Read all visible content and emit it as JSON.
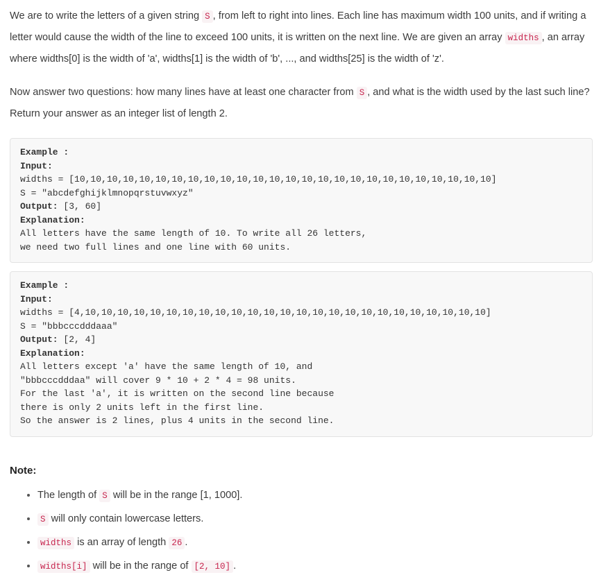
{
  "document": {
    "type": "problem-statement",
    "paragraphs": [
      {
        "id": "intro",
        "segments": [
          {
            "kind": "text",
            "value": "We are to write the letters of a given string "
          },
          {
            "kind": "code",
            "value": "S"
          },
          {
            "kind": "text",
            "value": ", from left to right into lines. Each line has maximum width 100 units, and if writing a letter would cause the width of the line to exceed 100 units, it is written on the next line. We are given an array "
          },
          {
            "kind": "code",
            "value": "widths"
          },
          {
            "kind": "text",
            "value": ", an array where widths[0] is the width of 'a', widths[1] is the width of 'b', ..., and widths[25] is the width of 'z'."
          }
        ]
      },
      {
        "id": "questions",
        "segments": [
          {
            "kind": "text",
            "value": "Now answer two questions: how many lines have at least one character from "
          },
          {
            "kind": "code",
            "value": "S"
          },
          {
            "kind": "text",
            "value": ", and what is the width used by the last such line? Return your answer as an integer list of length 2."
          }
        ]
      }
    ],
    "examples": [
      {
        "id": "example-1",
        "heading": "Example :",
        "input_label": "Input:",
        "widths_line": "widths = [10,10,10,10,10,10,10,10,10,10,10,10,10,10,10,10,10,10,10,10,10,10,10,10,10,10]",
        "s_line": "S = \"abcdefghijklmnopqrstuvwxyz\"",
        "output_label": "Output:",
        "output_value": "[3, 60]",
        "explanation_label": "Explanation:",
        "explanation_lines": [
          "All letters have the same length of 10. To write all 26 letters,",
          "we need two full lines and one line with 60 units."
        ]
      },
      {
        "id": "example-2",
        "heading": "Example :",
        "input_label": "Input:",
        "widths_line": "widths = [4,10,10,10,10,10,10,10,10,10,10,10,10,10,10,10,10,10,10,10,10,10,10,10,10,10]",
        "s_line": "S = \"bbbcccdddaaa\"",
        "output_label": "Output:",
        "output_value": "[2, 4]",
        "explanation_label": "Explanation:",
        "explanation_lines": [
          "All letters except 'a' have the same length of 10, and",
          "\"bbbcccdddaa\" will cover 9 * 10 + 2 * 4 = 98 units.",
          "For the last 'a', it is written on the second line because",
          "there is only 2 units left in the first line.",
          "So the answer is 2 lines, plus 4 units in the second line."
        ]
      }
    ],
    "note": {
      "title": "Note:",
      "items": [
        {
          "id": "note-1",
          "segments": [
            {
              "kind": "text",
              "value": "The length of "
            },
            {
              "kind": "code",
              "value": "S"
            },
            {
              "kind": "text",
              "value": " will be in the range [1, 1000]."
            }
          ]
        },
        {
          "id": "note-2",
          "segments": [
            {
              "kind": "code",
              "value": "S"
            },
            {
              "kind": "text",
              "value": " will only contain lowercase letters."
            }
          ]
        },
        {
          "id": "note-3",
          "segments": [
            {
              "kind": "code",
              "value": "widths"
            },
            {
              "kind": "text",
              "value": " is an array of length "
            },
            {
              "kind": "code",
              "value": "26"
            },
            {
              "kind": "text",
              "value": "."
            }
          ]
        },
        {
          "id": "note-4",
          "segments": [
            {
              "kind": "code",
              "value": "widths[i]"
            },
            {
              "kind": "text",
              "value": " will be in the range of "
            },
            {
              "kind": "code",
              "value": "[2, 10]"
            },
            {
              "kind": "text",
              "value": "."
            }
          ]
        }
      ]
    },
    "colors": {
      "background": "#ffffff",
      "body_text": "#3b3b3b",
      "code_text": "#c7254e",
      "code_background": "#f9f2f4",
      "example_background": "#f8f8f8",
      "example_border": "#e3e3e3"
    }
  }
}
